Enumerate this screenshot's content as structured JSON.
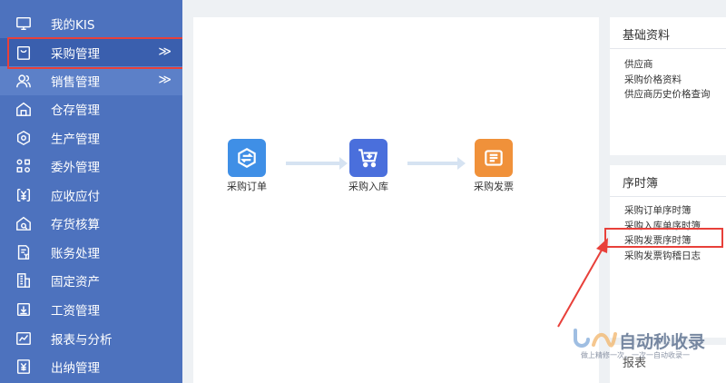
{
  "sidebar": {
    "items": [
      {
        "label": "我的KIS",
        "icon": "monitor-icon"
      },
      {
        "label": "采购管理",
        "icon": "shopping-bag-icon",
        "chevron": "≫"
      },
      {
        "label": "销售管理",
        "icon": "users-icon",
        "chevron": "≫"
      },
      {
        "label": "仓存管理",
        "icon": "warehouse-icon"
      },
      {
        "label": "生产管理",
        "icon": "hexagon-icon"
      },
      {
        "label": "委外管理",
        "icon": "grid-icon"
      },
      {
        "label": "应收应付",
        "icon": "yuan-icon"
      },
      {
        "label": "存货核算",
        "icon": "house-search-icon"
      },
      {
        "label": "账务处理",
        "icon": "document-yuan-icon"
      },
      {
        "label": "固定资产",
        "icon": "building-icon"
      },
      {
        "label": "工资管理",
        "icon": "download-box-icon"
      },
      {
        "label": "报表与分析",
        "icon": "chart-icon"
      },
      {
        "label": "出纳管理",
        "icon": "cash-icon"
      }
    ]
  },
  "flow": {
    "nodes": [
      {
        "label": "采购订单",
        "icon": "exchange-icon",
        "color": "#3f8fe6"
      },
      {
        "label": "采购入库",
        "icon": "cart-icon",
        "color": "#4a6fdc"
      },
      {
        "label": "采购发票",
        "icon": "invoice-icon",
        "color": "#f0913a"
      }
    ]
  },
  "panels": {
    "basic": {
      "title": "基础资料",
      "links": [
        "供应商",
        "采购价格资料",
        "供应商历史价格查询"
      ]
    },
    "sequence": {
      "title": "序时簿",
      "links": [
        "采购订单序时簿",
        "采购入库单序时簿",
        "采购发票序时簿",
        "采购发票钩稽日志"
      ]
    },
    "report": {
      "title": "报表"
    }
  },
  "watermark": {
    "brand": "自动秒收录",
    "slogan": "做上精修一次，一次一自动收录一"
  },
  "colors": {
    "sidebar": "#4d72be",
    "highlight": "#e8403a"
  }
}
